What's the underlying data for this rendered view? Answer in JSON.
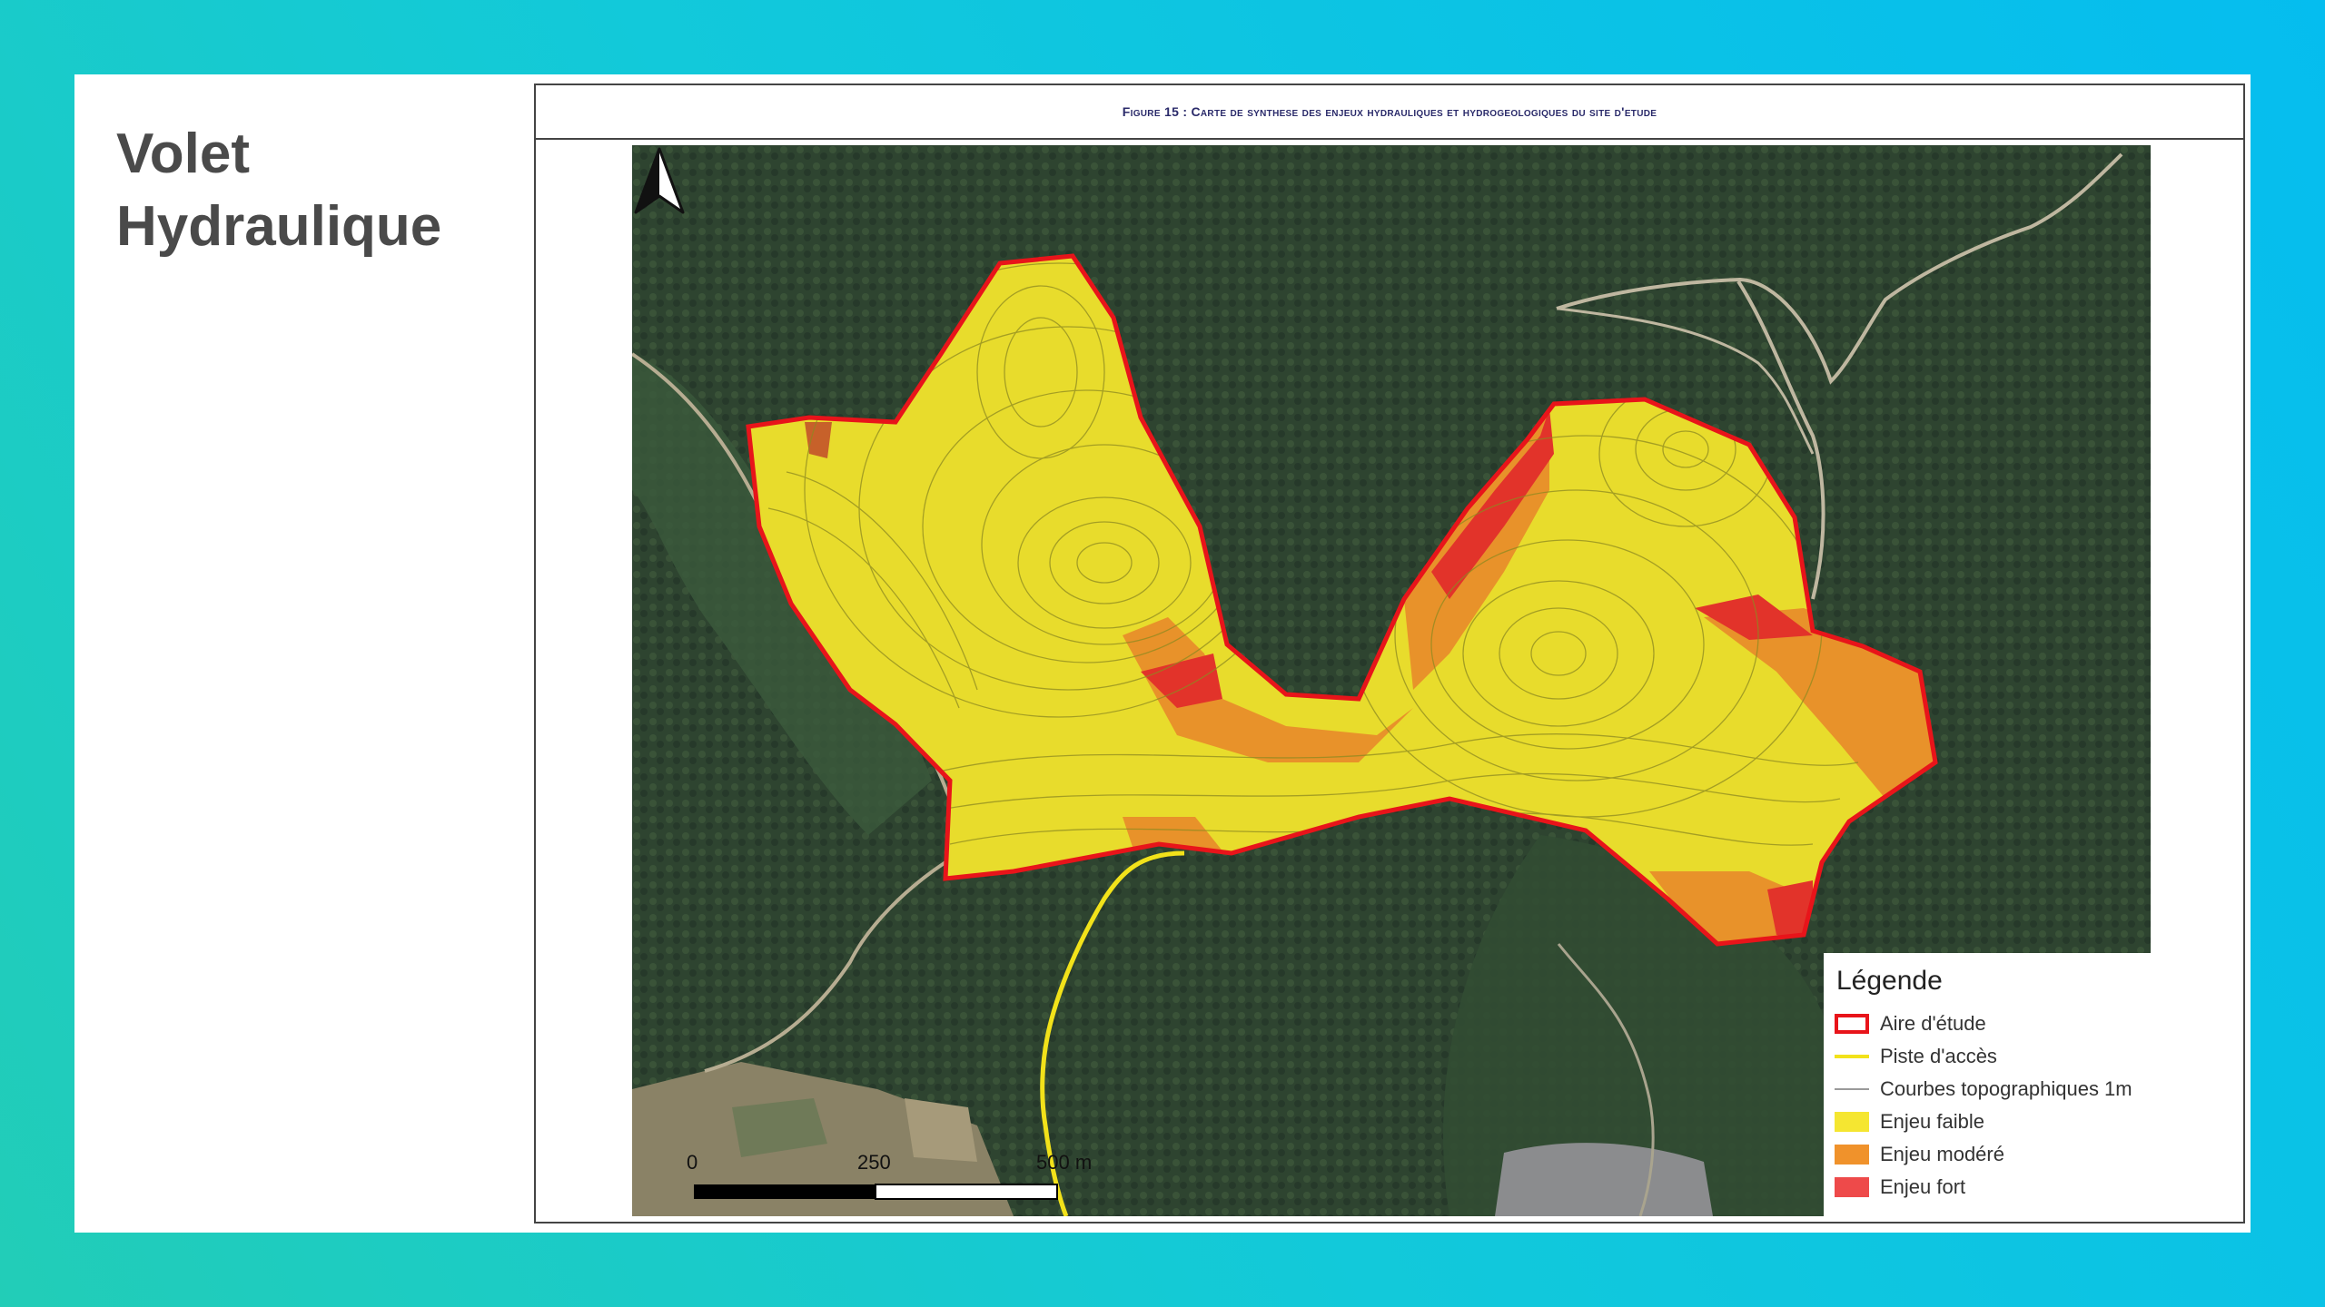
{
  "slide": {
    "title_line1": "Volet",
    "title_line2": "Hydraulique"
  },
  "figure": {
    "caption": "Figure 15 : Carte de synthese des enjeux hydrauliques et hydrogeologiques du site d'etude"
  },
  "legend": {
    "title": "Légende",
    "items": [
      {
        "label": "Aire d'étude",
        "symbol": "outline",
        "color": "#e8141a"
      },
      {
        "label": "Piste d'accès",
        "symbol": "line",
        "color": "#f2e21a"
      },
      {
        "label": "Courbes topographiques 1m",
        "symbol": "thin-line",
        "color": "#9a9a9a"
      },
      {
        "label": "Enjeu faible",
        "symbol": "fill",
        "color": "#f5e631"
      },
      {
        "label": "Enjeu modéré",
        "symbol": "fill",
        "color": "#f0922b"
      },
      {
        "label": "Enjeu fort",
        "symbol": "fill",
        "color": "#ee4a4a"
      }
    ]
  },
  "scale_bar": {
    "labels": [
      "0",
      "250",
      "500 m"
    ]
  },
  "icons": {
    "north_arrow": "north-arrow-icon"
  }
}
